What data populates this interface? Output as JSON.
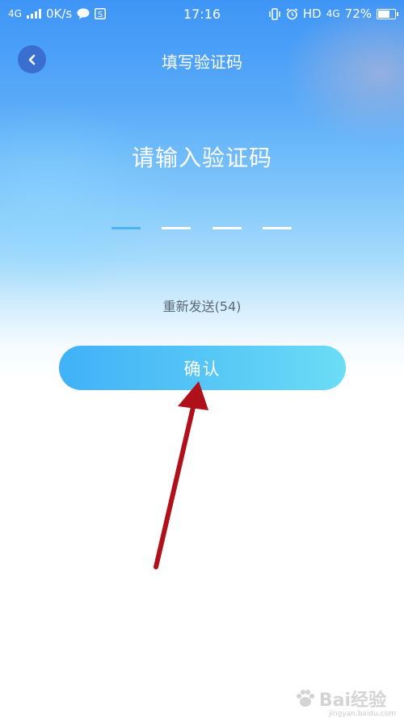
{
  "status_bar": {
    "network": "4G",
    "speed": "0K/s",
    "time": "17:16",
    "hd": "HD",
    "network_right": "4G",
    "battery": "72%",
    "icons": [
      "signal-icon",
      "chat-bubble-icon",
      "app-s-icon",
      "vibrate-icon",
      "alarm-icon",
      "battery-icon"
    ]
  },
  "header": {
    "title": "填写验证码",
    "back_icon": "chevron-left-icon"
  },
  "main": {
    "prompt": "请输入验证码",
    "code_slots": 4,
    "resend_label": "重新发送(54)",
    "confirm_label": "确认"
  },
  "colors": {
    "accent": "#41b1f8",
    "active_slot": "#4cb3f7",
    "annotation_arrow": "#b0101a"
  },
  "watermark": {
    "text": "Bai经验",
    "sub": "jingyan.baidu.com"
  }
}
